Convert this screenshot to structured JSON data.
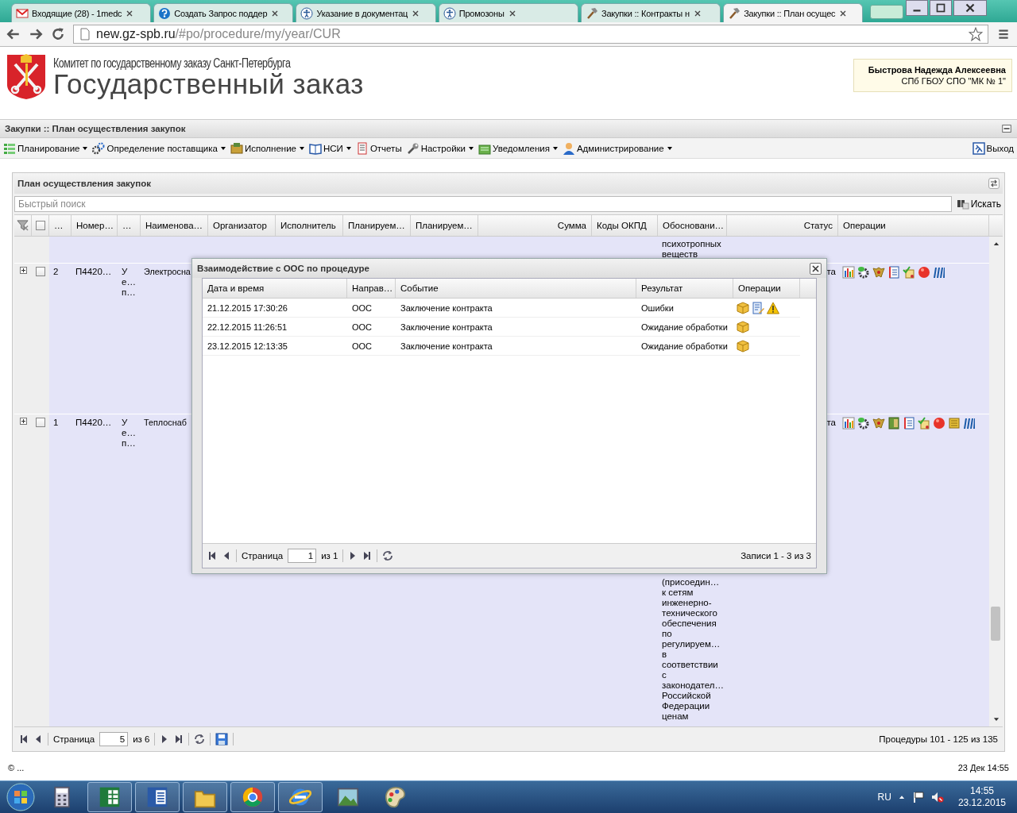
{
  "browser": {
    "tabs": [
      {
        "title": "Входящие (28) - 1medc",
        "selected": false
      },
      {
        "title": "Создать Запрос поддер",
        "selected": false
      },
      {
        "title": "Указание в документац",
        "selected": false
      },
      {
        "title": "Промозоны",
        "selected": false
      },
      {
        "title": "Закупки :: Контракты н",
        "selected": false
      },
      {
        "title": "Закупки :: План осущес",
        "selected": true
      }
    ],
    "url_host": "new.gz-spb.ru",
    "url_path": "/#po/procedure/my/year/CUR"
  },
  "header": {
    "organization": "Комитет по государственному заказу Санкт-Петербурга",
    "title": "Государственный заказ",
    "user": {
      "name": "Быстрова Надежда Алексеевна",
      "org": "СПб ГБОУ СПО \"МК № 1\""
    }
  },
  "app_title": "Закупки :: План осуществления закупок",
  "menu": [
    {
      "label": "Планирование",
      "dropdown": true
    },
    {
      "label": "Определение поставщика",
      "dropdown": true
    },
    {
      "label": "Исполнение",
      "dropdown": true
    },
    {
      "label": "НСИ",
      "dropdown": true
    },
    {
      "label": "Отчеты",
      "dropdown": false
    },
    {
      "label": "Настройки",
      "dropdown": true
    },
    {
      "label": "Уведомления",
      "dropdown": true
    },
    {
      "label": "Администрирование",
      "dropdown": true
    }
  ],
  "exit": "Выход",
  "grid": {
    "title": "План осуществления закупок",
    "search": {
      "placeholder": "Быстрый поиск",
      "button": "Искать"
    },
    "select_all": {
      "checked": false
    },
    "columns": [
      "…",
      "Номер…",
      "…",
      "Наименова…",
      "Организатор",
      "Исполнитель",
      "Планируем…",
      "Планируем…",
      "Сумма",
      "Коды ОКПД",
      "Обосновани…",
      "Статус",
      "Операции"
    ],
    "partial_row": {
      "justification": "психотропных\nвеществ"
    },
    "rows": [
      {
        "expanded": false,
        "checked": false,
        "index": "2",
        "number": "П4420…",
        "column_3": "У\nе…\nп…",
        "name": "Электросна",
        "status": "та"
      },
      {
        "expanded": false,
        "checked": false,
        "index": "1",
        "number": "П4420…",
        "column_3": "У\nе…\nп…",
        "name": "Теплоснаб",
        "justification": "(присоедин…\nк сетям\nинженерно-\nтехнического\nобеспечения\nпо\nрегулируем…\nв\nсоответствии\nс\nзаконодател…\nРоссийской\nФедерации\nценам",
        "status": "та"
      }
    ],
    "pager": {
      "page_label": "Страница",
      "page": "5",
      "of": "из 6",
      "summary": "Процедуры 101 - 125 из 135"
    }
  },
  "dialog": {
    "title": "Взаимодействие с ООС по процедуре",
    "columns": [
      "Дата и время",
      "Направ…",
      "Событие",
      "Результат",
      "Операции"
    ],
    "rows": [
      {
        "datetime": "21.12.2015 17:30:26",
        "direction": "ООС",
        "event": "Заключение контракта",
        "result": "Ошибки"
      },
      {
        "datetime": "22.12.2015 11:26:51",
        "direction": "ООС",
        "event": "Заключение контракта",
        "result": "Ожидание обработки"
      },
      {
        "datetime": "23.12.2015 12:13:35",
        "direction": "ООС",
        "event": "Заключение контракта",
        "result": "Ожидание обработки"
      }
    ],
    "pager": {
      "page_label": "Страница",
      "page": "1",
      "of": "из 1",
      "summary": "Записи 1 - 3 из 3"
    }
  },
  "footer": {
    "copyright": "© ...",
    "datetime": "23 Дек 14:55"
  },
  "taskbar": {
    "language": "RU",
    "time": "14:55",
    "date": "23.12.2015"
  }
}
